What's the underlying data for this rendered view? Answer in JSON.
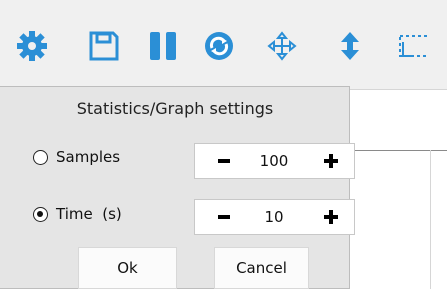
{
  "toolbar": {
    "icons": [
      "gear-icon",
      "save-icon",
      "pause-icon",
      "refresh-icon",
      "move-icon",
      "vertical-resize-icon",
      "selection-icon"
    ],
    "accent_color": "#2b8fd6"
  },
  "dialog": {
    "title": "Statistics/Graph settings",
    "options": [
      {
        "label": "Samples",
        "selected": false,
        "value": "100"
      },
      {
        "label": "Time  (s)",
        "selected": true,
        "value": "10"
      }
    ],
    "ok_label": "Ok",
    "cancel_label": "Cancel"
  }
}
